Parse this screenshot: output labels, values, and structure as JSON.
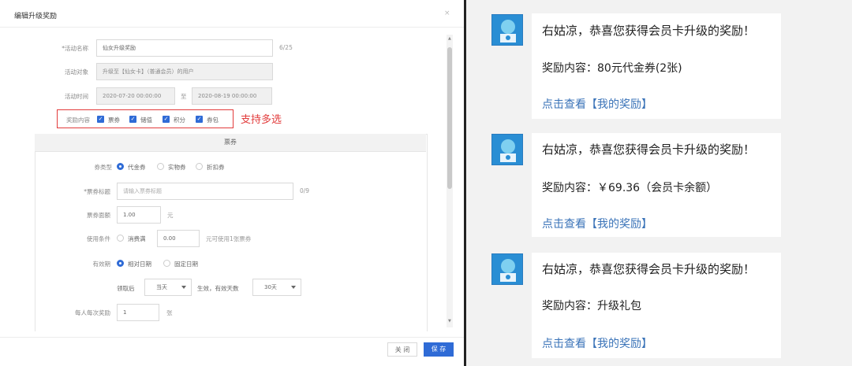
{
  "dialog": {
    "title": "编辑升级奖励",
    "close_label": "×",
    "fields": {
      "activity_name": {
        "label": "*活动名称",
        "value": "仙女升级奖励",
        "count": "6/25"
      },
      "activity_target": {
        "label": "活动对象",
        "value": "升级至【仙女卡】（普通会员）的用户"
      },
      "activity_time": {
        "label": "活动时间",
        "start": "2020-07-20 00:00:00",
        "separator": "至",
        "end": "2020-08-19 00:00:00"
      },
      "reward_content": {
        "label": "奖励内容",
        "options": [
          "票券",
          "储值",
          "积分",
          "券包"
        ],
        "checked": [
          true,
          true,
          true,
          true
        ]
      }
    },
    "multi_select_note": "支持多选",
    "coupon_panel": {
      "title": "票券",
      "coupon_type": {
        "label": "券类型",
        "options": [
          "代金券",
          "实物券",
          "折扣券"
        ],
        "selected": "代金券"
      },
      "coupon_title": {
        "label": "*票券标题",
        "placeholder": "请输入票券标题",
        "count": "0/9"
      },
      "coupon_amount": {
        "label": "票券面额",
        "value": "1.00",
        "unit": "元"
      },
      "use_condition": {
        "label": "使用条件",
        "option": "消费满",
        "value": "0.00",
        "suffix": "元可使用1张票券"
      },
      "validity": {
        "label": "有效期",
        "options": [
          "相对日期",
          "固定日期"
        ],
        "selected": "相对日期"
      },
      "validity_detail": {
        "prefix": "领取后",
        "start_select": "当天",
        "middle": "生效，有效天数",
        "days_select": "30天"
      },
      "per_reward": {
        "label": "每人每次奖励",
        "value": "1",
        "unit": "张"
      }
    },
    "footer": {
      "close_button": "关 闭",
      "save_button": "保 存"
    },
    "scroll_up": "▲",
    "scroll_down": "▼"
  },
  "chat": {
    "messages": [
      {
        "line1": "右姑凉，恭喜您获得会员卡升级的奖励！",
        "line2": "奖励内容：80元代金券(2张)",
        "link": "点击查看【我的奖励】"
      },
      {
        "line1": "右姑凉，恭喜您获得会员卡升级的奖励！",
        "line2": "奖励内容：￥69.36（会员卡余额）",
        "link": "点击查看【我的奖励】"
      },
      {
        "line1": "右姑凉，恭喜您获得会员卡升级的奖励！",
        "line2": "奖励内容：升级礼包",
        "link": "点击查看【我的奖励】"
      }
    ]
  },
  "colors": {
    "primary": "#2f6bd6",
    "highlight_red": "#e23b3b",
    "link_blue": "#3a73b8",
    "avatar_blue": "#2a8ed4"
  }
}
